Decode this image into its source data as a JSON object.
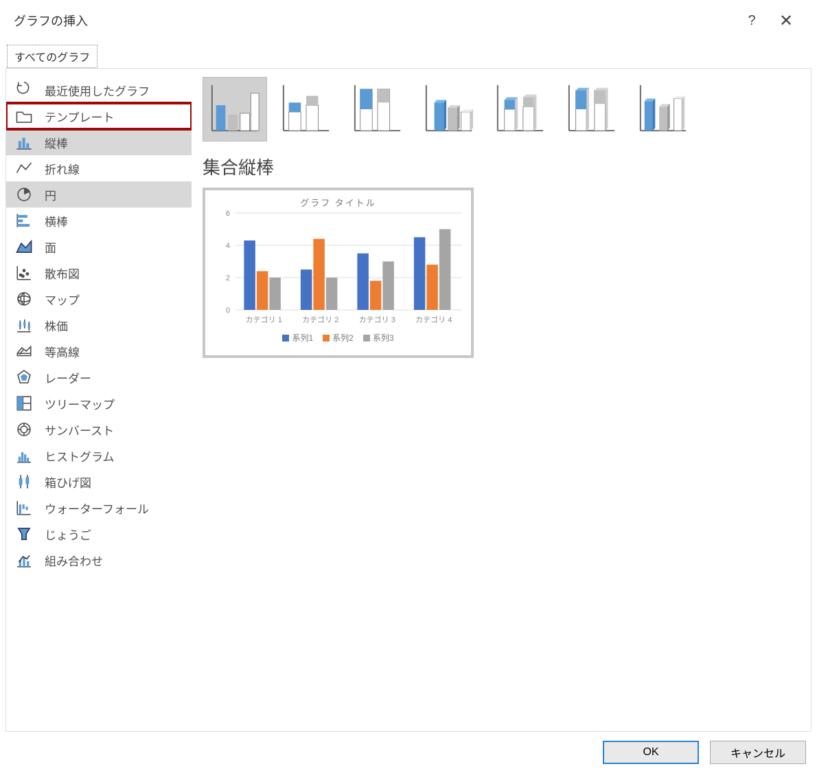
{
  "dialog": {
    "title": "グラフの挿入",
    "help_tooltip": "?",
    "close_tooltip": "×"
  },
  "tabs": {
    "all_charts": "すべてのグラフ"
  },
  "sidebar": {
    "items": [
      {
        "id": "recent",
        "label": "最近使用したグラフ",
        "icon": "recent"
      },
      {
        "id": "templates",
        "label": "テンプレート",
        "icon": "folder",
        "highlighted": true
      },
      {
        "id": "column",
        "label": "縦棒",
        "icon": "column",
        "selected_visual": true
      },
      {
        "id": "line",
        "label": "折れ線",
        "icon": "line"
      },
      {
        "id": "pie",
        "label": "円",
        "icon": "pie",
        "selected": true
      },
      {
        "id": "bar",
        "label": "横棒",
        "icon": "bar"
      },
      {
        "id": "area",
        "label": "面",
        "icon": "area"
      },
      {
        "id": "scatter",
        "label": "散布図",
        "icon": "scatter"
      },
      {
        "id": "map",
        "label": "マップ",
        "icon": "map"
      },
      {
        "id": "stock",
        "label": "株価",
        "icon": "stock"
      },
      {
        "id": "surface",
        "label": "等高線",
        "icon": "surface"
      },
      {
        "id": "radar",
        "label": "レーダー",
        "icon": "radar"
      },
      {
        "id": "treemap",
        "label": "ツリーマップ",
        "icon": "treemap"
      },
      {
        "id": "sunburst",
        "label": "サンバースト",
        "icon": "sunburst"
      },
      {
        "id": "histogram",
        "label": "ヒストグラム",
        "icon": "histogram"
      },
      {
        "id": "boxwhisker",
        "label": "箱ひげ図",
        "icon": "box"
      },
      {
        "id": "waterfall",
        "label": "ウォーターフォール",
        "icon": "waterfall"
      },
      {
        "id": "funnel",
        "label": "じょうご",
        "icon": "funnel"
      },
      {
        "id": "combo",
        "label": "組み合わせ",
        "icon": "combo"
      }
    ]
  },
  "subtypes": {
    "items": [
      {
        "id": "clustered-column",
        "selected": true
      },
      {
        "id": "stacked-column"
      },
      {
        "id": "100-stacked-column"
      },
      {
        "id": "3d-clustered-column"
      },
      {
        "id": "3d-stacked-column"
      },
      {
        "id": "3d-100-stacked-column"
      },
      {
        "id": "3d-column"
      }
    ]
  },
  "preview": {
    "heading": "集合縦棒",
    "chart_title": "グラフ タイトル",
    "legend": [
      "系列1",
      "系列2",
      "系列3"
    ],
    "categories_prefix": "カテゴリ"
  },
  "footer": {
    "ok": "OK",
    "cancel": "キャンセル"
  },
  "colors": {
    "series1": "#4472c4",
    "series2": "#ed7d31",
    "series3": "#a5a5a5",
    "accent_blue": "#5b9bd5",
    "highlight_red": "#a00808"
  },
  "chart_data": {
    "type": "bar",
    "title": "グラフ タイトル",
    "xlabel": "",
    "ylabel": "",
    "ylim": [
      0,
      6
    ],
    "yticks": [
      0,
      2,
      4,
      6
    ],
    "categories": [
      "カテゴリ 1",
      "カテゴリ 2",
      "カテゴリ 3",
      "カテゴリ 4"
    ],
    "series": [
      {
        "name": "系列1",
        "color": "#4472c4",
        "values": [
          4.3,
          2.5,
          3.5,
          4.5
        ]
      },
      {
        "name": "系列2",
        "color": "#ed7d31",
        "values": [
          2.4,
          4.4,
          1.8,
          2.8
        ]
      },
      {
        "name": "系列3",
        "color": "#a5a5a5",
        "values": [
          2.0,
          2.0,
          3.0,
          5.0
        ]
      }
    ]
  }
}
